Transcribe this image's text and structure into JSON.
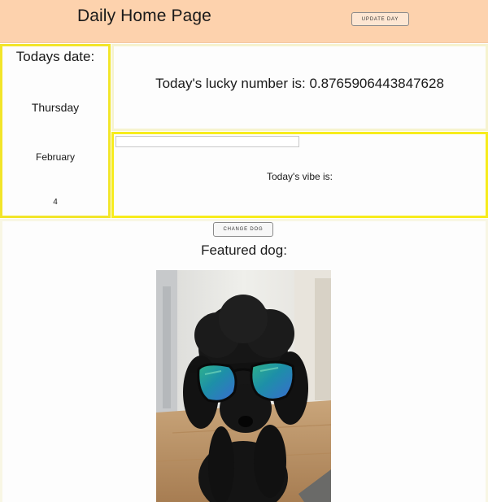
{
  "header": {
    "title": "Daily Home Page",
    "update_button_label": "UPDATE DAY"
  },
  "date_panel": {
    "title": "Todays date:",
    "weekday": "Thursday",
    "month": "February",
    "day": "4"
  },
  "lucky_panel": {
    "text": "Today's lucky number is: 0.8765906443847628"
  },
  "vibe_panel": {
    "input_value": "",
    "label": "Today's vibe is:"
  },
  "dog_panel": {
    "change_button_label": "CHANGE DOG",
    "title": "Featured dog:",
    "photo_alt": "black poodle wearing mirrored sunglasses"
  },
  "colors": {
    "header_bg": "#fdd2ad",
    "panel_border_yellow": "#f2e52a",
    "panel_bg": "#fdfdfd"
  }
}
